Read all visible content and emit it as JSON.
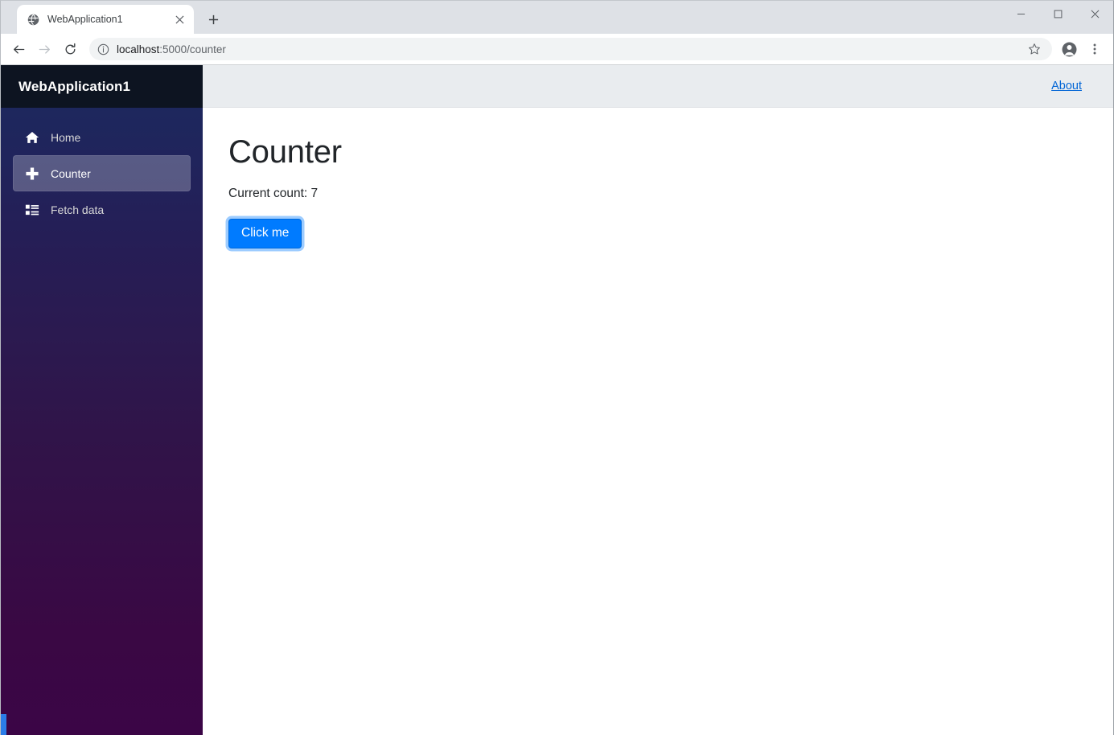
{
  "browser": {
    "tab": {
      "title": "WebApplication1",
      "favicon_icon": "globe-icon",
      "close_icon": "close-icon"
    },
    "new_tab_icon": "plus-icon",
    "window_controls": {
      "minimize_icon": "minimize-icon",
      "maximize_icon": "maximize-icon",
      "close_icon": "close-icon"
    },
    "toolbar": {
      "back_icon": "back-arrow-icon",
      "forward_icon": "forward-arrow-icon",
      "reload_icon": "reload-icon",
      "site_info_icon": "info-circle-icon",
      "url_host": "localhost",
      "url_path": ":5000/counter",
      "url_full": "localhost:5000/counter",
      "bookmark_icon": "star-icon",
      "profile_icon": "profile-avatar-icon",
      "menu_icon": "three-dot-menu-icon"
    }
  },
  "app": {
    "sidebar": {
      "brand": "WebApplication1",
      "items": [
        {
          "label": "Home",
          "icon": "home-icon",
          "active": false
        },
        {
          "label": "Counter",
          "icon": "plus-icon",
          "active": true
        },
        {
          "label": "Fetch data",
          "icon": "list-icon",
          "active": false
        }
      ]
    },
    "topbar": {
      "about_label": "About"
    },
    "page": {
      "title": "Counter",
      "count_label": "Current count: 7",
      "button_label": "Click me"
    }
  },
  "colors": {
    "accent_blue": "#007bff",
    "link_blue": "#0366d6",
    "sidebar_top": "#1b2a5e",
    "sidebar_bottom": "#3b0546",
    "sidebar_brand_bg": "#0d1421",
    "topbar_bg": "#e9ecef"
  }
}
